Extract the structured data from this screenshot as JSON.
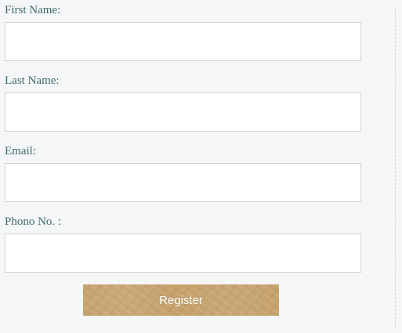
{
  "form": {
    "fields": [
      {
        "label": "First Name:",
        "value": "",
        "placeholder": ""
      },
      {
        "label": "Last Name:",
        "value": "",
        "placeholder": ""
      },
      {
        "label": "Email:",
        "value": "",
        "placeholder": ""
      },
      {
        "label": "Phono No. :",
        "value": "",
        "placeholder": ""
      }
    ],
    "submit_label": "Register"
  },
  "colors": {
    "label_text": "#3e6b6b",
    "button_bg": "#c4a06a",
    "page_bg": "#f5f6f7"
  }
}
